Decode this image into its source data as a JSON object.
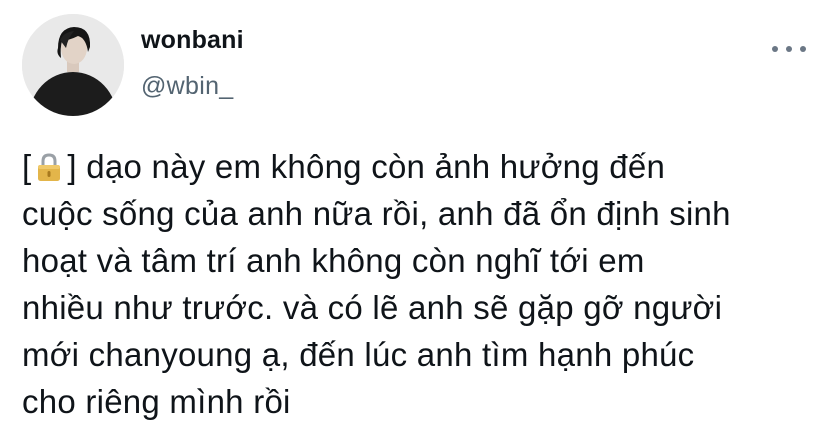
{
  "tweet": {
    "author": {
      "display_name": "wonbani",
      "handle": "@wbin_",
      "avatar_icon": "profile-photo"
    },
    "more_icon": "more-horizontal-icon",
    "text_lines": [
      {
        "before": "[",
        "icon": "lock-icon",
        "after": "] dạo này em không còn ảnh hưởng đến"
      },
      {
        "text": "cuộc sống của anh nữa rồi, anh đã ổn định sinh"
      },
      {
        "text": "hoạt và tâm trí anh không còn nghĩ tới em"
      },
      {
        "text": "nhiều như trước. và có lẽ anh sẽ gặp gỡ người"
      },
      {
        "text": "mới chanyoung ạ, đến lúc anh tìm hạnh phúc"
      },
      {
        "text": "cho riêng mình rồi"
      }
    ]
  },
  "colors": {
    "background": "#ffffff",
    "primary_text": "#0f1419",
    "secondary_text": "#536471",
    "icon_gray": "#6b7785"
  }
}
